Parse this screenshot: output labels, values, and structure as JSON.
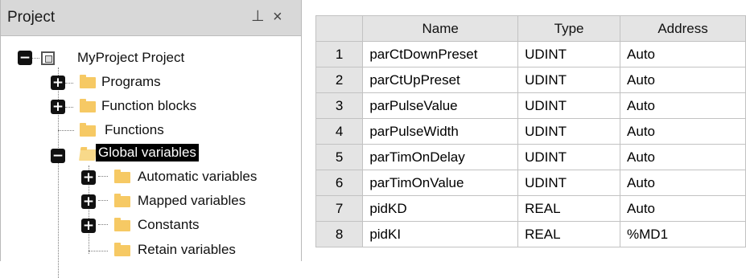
{
  "panel": {
    "title": "Project",
    "pin_glyph": "⊥",
    "close_glyph": "×",
    "icons": {
      "pin": "pin-icon",
      "close": "close-icon"
    }
  },
  "tree": {
    "root": {
      "label": "MyProject Project",
      "expander": "−",
      "icon": "project-icon"
    },
    "programs": {
      "label": "Programs",
      "expander": "+"
    },
    "function_blocks": {
      "label": "Function blocks",
      "expander": "+"
    },
    "functions": {
      "label": "Functions"
    },
    "global_variables": {
      "label": "Global variables",
      "expander": "−",
      "selected": true
    },
    "automatic_variables": {
      "label": "Automatic variables",
      "expander": "+"
    },
    "mapped_variables": {
      "label": "Mapped variables",
      "expander": "+"
    },
    "constants": {
      "label": "Constants",
      "expander": "+"
    },
    "retain_variables": {
      "label": "Retain variables"
    }
  },
  "grid": {
    "columns": [
      "",
      "Name",
      "Type",
      "Address"
    ],
    "rows": [
      {
        "n": "1",
        "name": "parCtDownPreset",
        "type": "UDINT",
        "address": "Auto"
      },
      {
        "n": "2",
        "name": "parCtUpPreset",
        "type": "UDINT",
        "address": "Auto"
      },
      {
        "n": "3",
        "name": "parPulseValue",
        "type": "UDINT",
        "address": "Auto"
      },
      {
        "n": "4",
        "name": "parPulseWidth",
        "type": "UDINT",
        "address": "Auto"
      },
      {
        "n": "5",
        "name": "parTimOnDelay",
        "type": "UDINT",
        "address": "Auto"
      },
      {
        "n": "6",
        "name": "parTimOnValue",
        "type": "UDINT",
        "address": "Auto"
      },
      {
        "n": "7",
        "name": "pidKD",
        "type": "REAL",
        "address": "Auto"
      },
      {
        "n": "8",
        "name": "pidKI",
        "type": "REAL",
        "address": "%MD1"
      }
    ]
  },
  "colors": {
    "header_bg": "#d8d8d8",
    "folder": "#f6c964",
    "selection": "#000000",
    "grid_header_bg": "#e4e4e4"
  }
}
